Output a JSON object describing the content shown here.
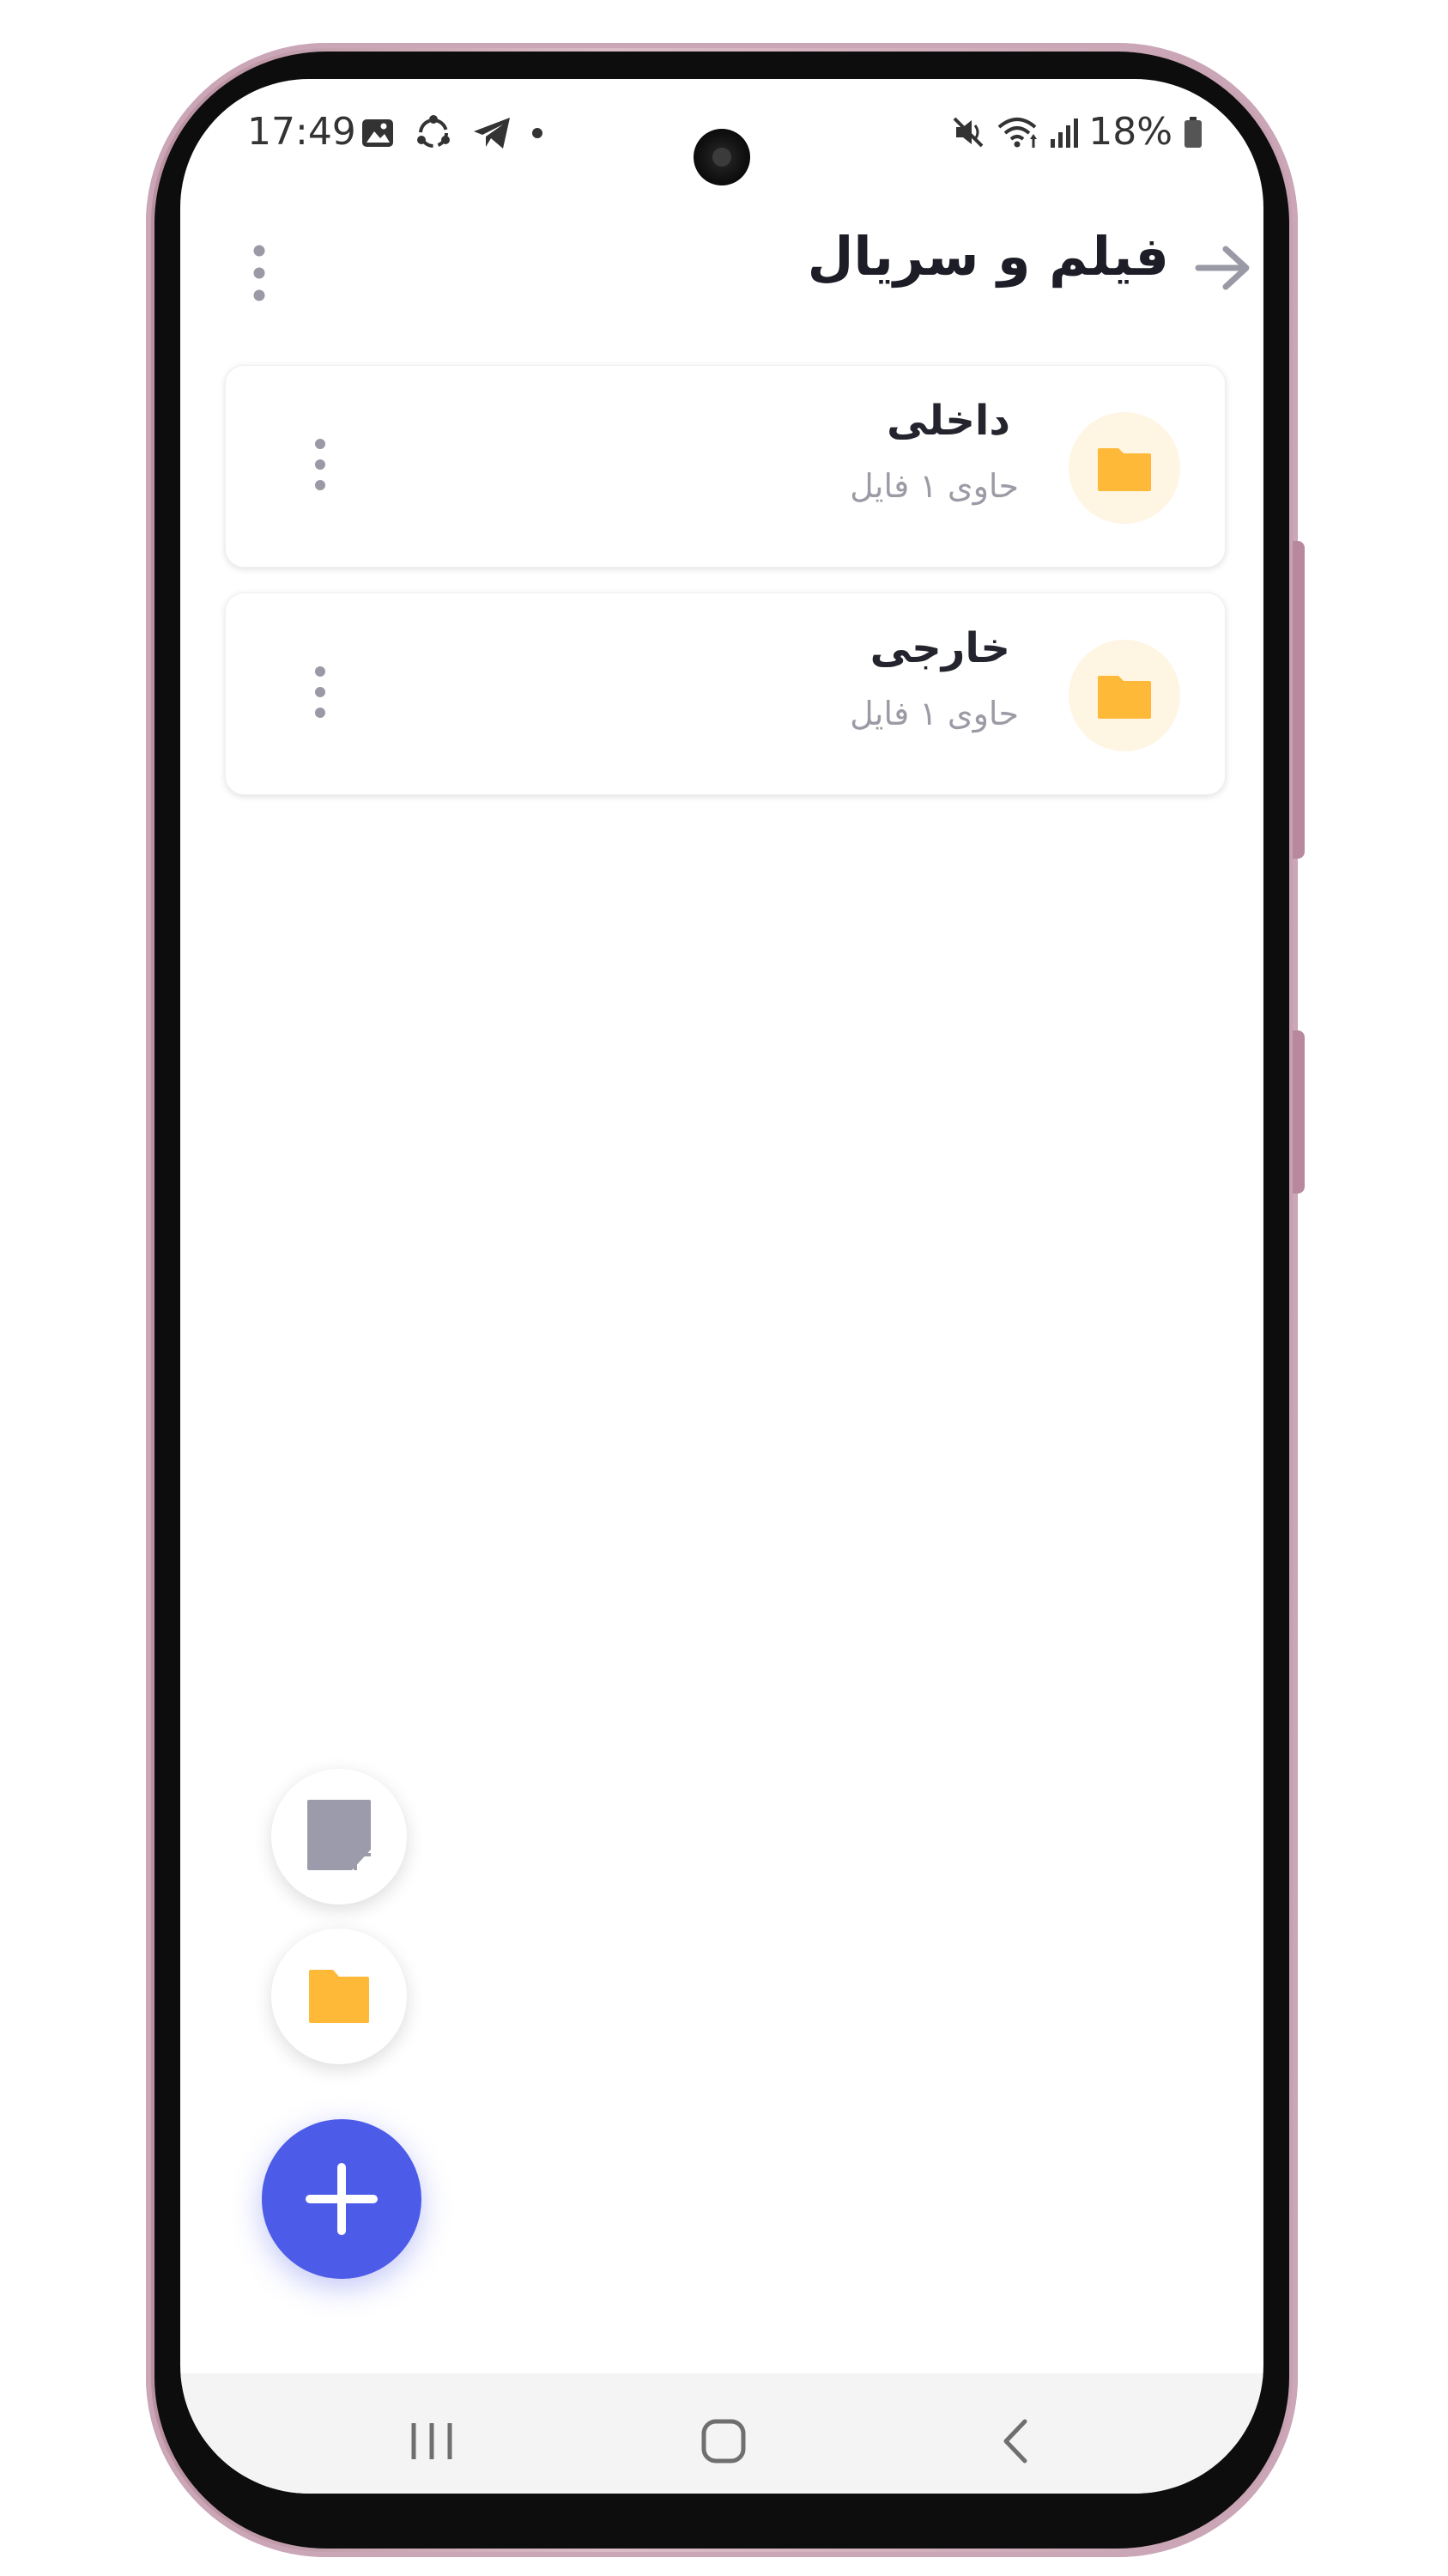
{
  "status_bar": {
    "time": "17:49",
    "battery": "18%",
    "left_icons": [
      "image-icon",
      "sync-icon",
      "telegram-icon",
      "dot-icon"
    ],
    "right_icons": [
      "mute-icon",
      "wifi-icon",
      "signal-icon",
      "battery-icon"
    ]
  },
  "app_bar": {
    "title": "فیلم و سریال",
    "back_icon": "arrow-right-icon",
    "menu_icon": "more-vert-icon"
  },
  "folders": [
    {
      "name": "داخلی",
      "subtitle": "حاوی ۱ فایل",
      "icon": "folder-icon"
    },
    {
      "name": "خارجی",
      "subtitle": "حاوی ۱ فایل",
      "icon": "folder-icon"
    }
  ],
  "fab": {
    "new_note_icon": "note-icon",
    "new_folder_icon": "folder-icon",
    "main_icon": "plus-icon"
  },
  "nav": {
    "recent_icon": "recent-apps-icon",
    "home_icon": "home-icon",
    "back_icon": "back-icon"
  },
  "colors": {
    "accent": "#4c5be8",
    "folder": "#fdb937",
    "folder_bg": "#fef5e3",
    "muted": "#9c9ba5"
  }
}
